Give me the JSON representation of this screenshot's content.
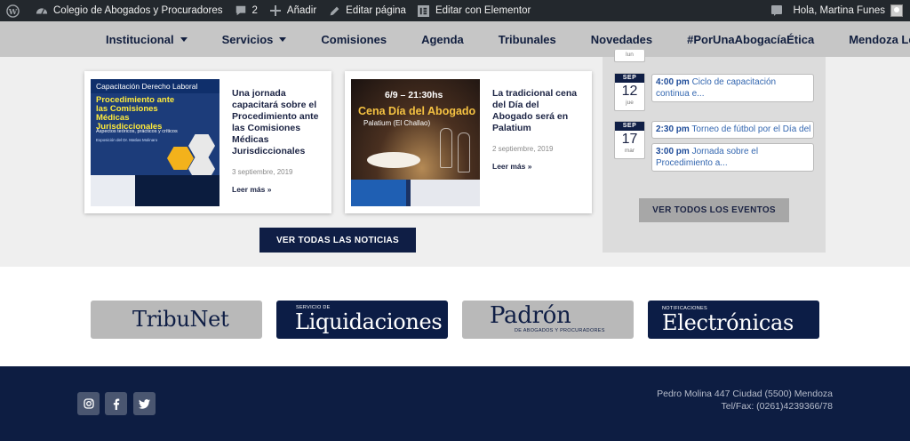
{
  "adminbar": {
    "site_name": "Colegio de Abogados y Procuradores",
    "comments_count": "2",
    "add_label": "Añadir",
    "edit_page_label": "Editar página",
    "elementor_label": "Editar con Elementor",
    "greeting": "Hola, Martina Funes"
  },
  "nav": {
    "items": [
      {
        "label": "Institucional",
        "dropdown": true
      },
      {
        "label": "Servicios",
        "dropdown": true
      },
      {
        "label": "Comisiones"
      },
      {
        "label": "Agenda"
      },
      {
        "label": "Tribunales"
      },
      {
        "label": "Novedades"
      },
      {
        "label": "#PorUnaAbogacíaÉtica"
      },
      {
        "label": "Mendoza Legal"
      }
    ]
  },
  "news": {
    "cards": [
      {
        "title": "Una jornada capacitará sobre el Procedimiento ante las Comisiones Médicas Jurisdiccionales",
        "date": "3 septiembre, 2019",
        "more": "Leer más »",
        "image": {
          "header": "Capacitación Derecho Laboral",
          "headline": "Procedimiento ante las Comisiones Médicas Jurisdiccionales",
          "subhead": "Aspectos teóricos, prácticos y críticos",
          "body": "Exposición del Dr. Matías Molinaro"
        }
      },
      {
        "title": "La tradicional cena del Día del Abogado será en Palatium",
        "date": "2 septiembre, 2019",
        "more": "Leer más »",
        "image": {
          "line1": "6/9 – 21:30hs",
          "line2": "Cena Día del Abogado",
          "line3": "Palatium (El Challao)"
        }
      }
    ],
    "all_button": "VER TODAS LAS NOTICIAS"
  },
  "events": {
    "groups": [
      {
        "month": "SEP",
        "day": "12",
        "weekday": "jue",
        "items": [
          {
            "time": "4:00 pm",
            "title": "Ciclo de capacitación continua e..."
          }
        ]
      },
      {
        "month": "SEP",
        "day": "17",
        "weekday": "mar",
        "items": [
          {
            "time": "2:30 pm",
            "title": "Torneo de fútbol por el Día del ..."
          },
          {
            "time": "3:00 pm",
            "title": "Jornada sobre el Procedimiento a..."
          }
        ]
      }
    ],
    "all_button": "VER TODOS LOS EVENTOS"
  },
  "banners": [
    {
      "big": "TribuNet"
    },
    {
      "small": "SERVICIO DE",
      "big": "Liquidaciones"
    },
    {
      "big": "Padrón",
      "small": "DE ABOGADOS Y PROCURADORES"
    },
    {
      "small": "NOTIFICACIONES",
      "big": "Electrónicas"
    }
  ],
  "footer": {
    "address": "Pedro Molina 447 Ciudad (5500) Mendoza Tel/Fax: (0261)4239366/78",
    "social": [
      "instagram-icon",
      "facebook-icon",
      "twitter-icon"
    ]
  }
}
